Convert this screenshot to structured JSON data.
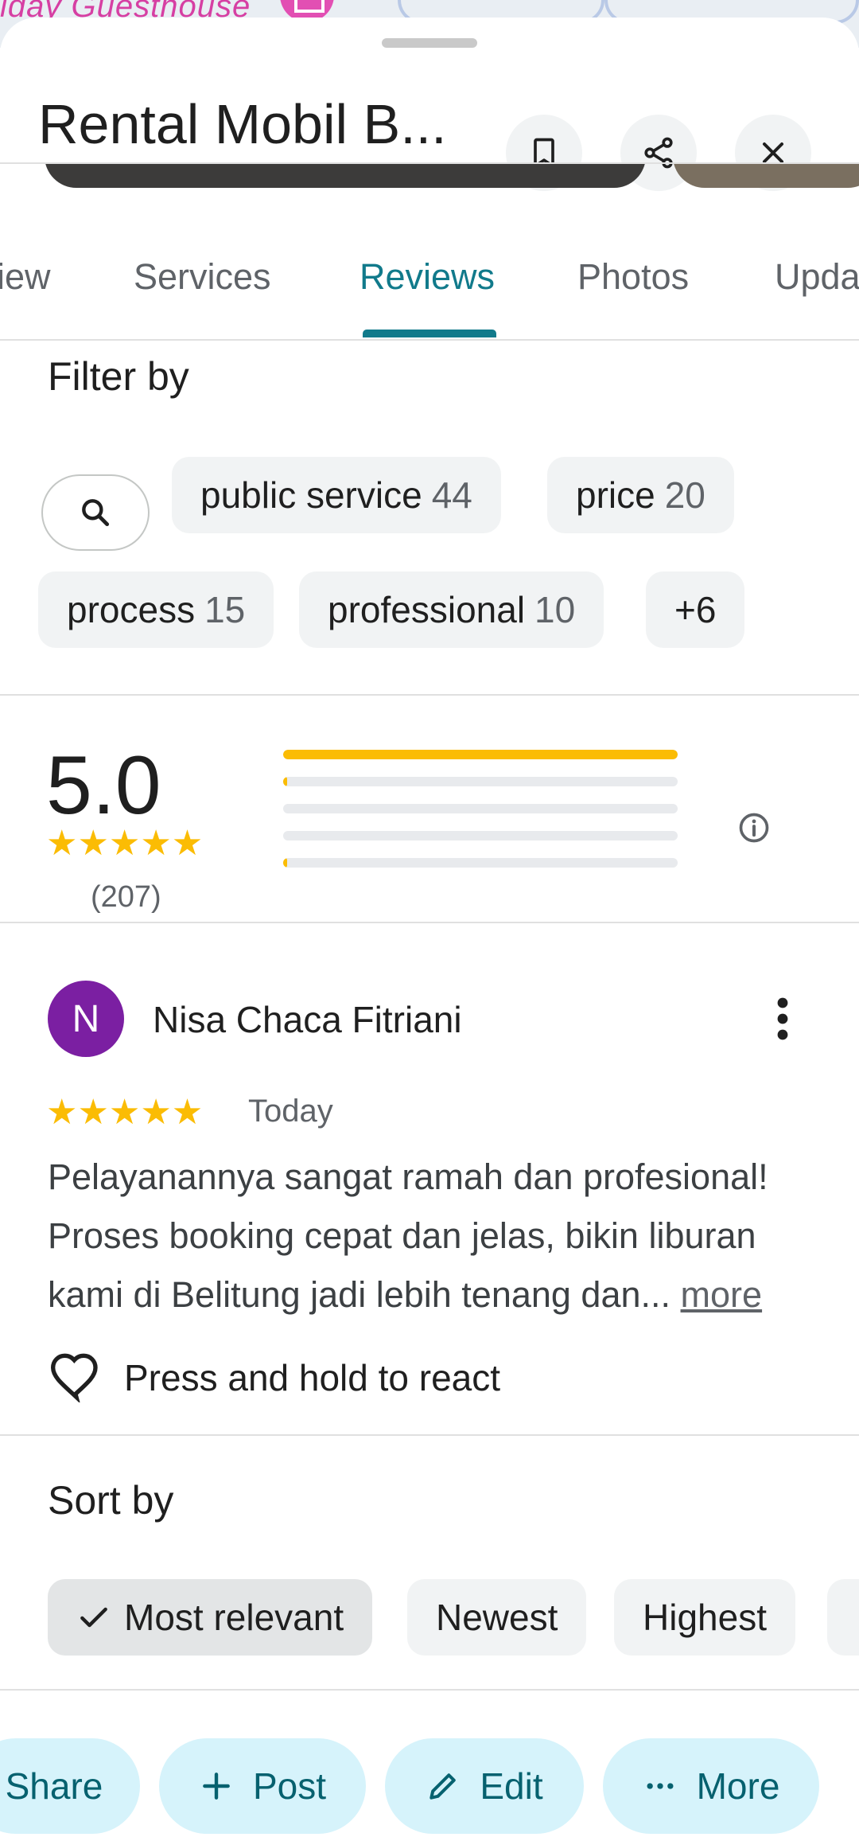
{
  "map": {
    "label": "iday Guesthouse"
  },
  "header": {
    "title": "Rental Mobil B...",
    "save_icon": "bookmark-icon",
    "share_icon": "share-icon",
    "close_icon": "close-icon"
  },
  "tabs": [
    {
      "label": "iew"
    },
    {
      "label": "Services"
    },
    {
      "label": "Reviews",
      "active": true
    },
    {
      "label": "Photos"
    },
    {
      "label": "Upda"
    }
  ],
  "filter": {
    "title": "Filter by",
    "search_icon": "search-icon",
    "chips": [
      {
        "label": "public service",
        "count": "44"
      },
      {
        "label": "price",
        "count": "20"
      },
      {
        "label": "process",
        "count": "15"
      },
      {
        "label": "professional",
        "count": "10"
      },
      {
        "label": "+6",
        "count": ""
      }
    ]
  },
  "rating": {
    "average": "5.0",
    "stars": "★★★★★",
    "count": "(207)",
    "distribution": [
      {
        "stars": 5,
        "fraction": 1.0
      },
      {
        "stars": 4,
        "fraction": 0.004
      },
      {
        "stars": 3,
        "fraction": 0.0
      },
      {
        "stars": 2,
        "fraction": 0.0
      },
      {
        "stars": 1,
        "fraction": 0.004
      }
    ],
    "info_icon": "info-icon"
  },
  "review": {
    "avatar_letter": "N",
    "avatar_color": "#7b1fa2",
    "author": "Nisa Chaca Fitriani",
    "stars": "★★★★★",
    "date": "Today",
    "text": "Pelayanannya sangat ramah dan profesional! Proses booking cepat dan jelas, bikin liburan kami di Belitung jadi lebih tenang dan...",
    "more_label": "more",
    "react_label": "Press and hold to react"
  },
  "sort": {
    "title": "Sort by",
    "options": [
      {
        "label": "Most relevant",
        "selected": true
      },
      {
        "label": "Newest"
      },
      {
        "label": "Highest"
      },
      {
        "label": ""
      }
    ]
  },
  "actions": [
    {
      "label": "Share",
      "icon": "share-icon"
    },
    {
      "label": "Post",
      "icon": "plus-icon"
    },
    {
      "label": "Edit",
      "icon": "pencil-icon"
    },
    {
      "label": "More",
      "icon": "ellipsis-icon"
    }
  ],
  "colors": {
    "accent": "#117a8b",
    "star": "#fbbc04",
    "action_bg": "#d6f3fb",
    "action_text": "#06616f"
  }
}
